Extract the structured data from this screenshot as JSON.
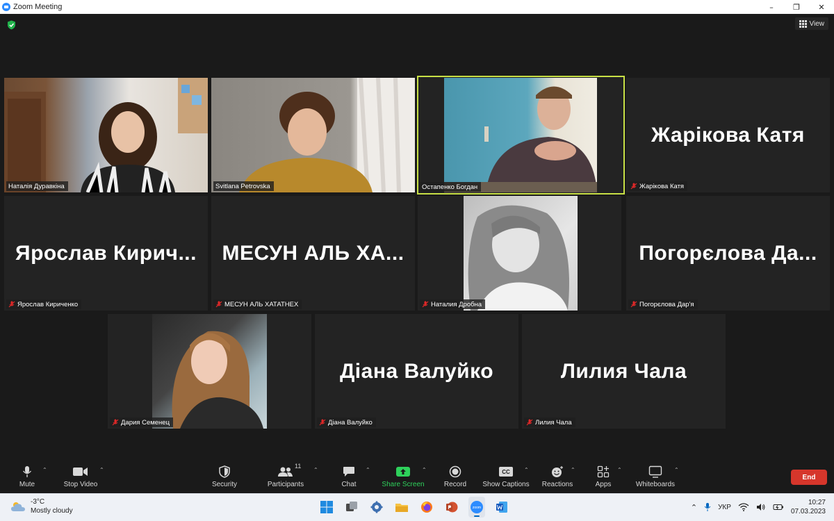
{
  "window": {
    "title": "Zoom Meeting",
    "controls": [
      "minimize",
      "maximize",
      "close"
    ]
  },
  "meeting": {
    "view_label": "View",
    "participants": [
      {
        "name": "Наталія Дуравкіна",
        "video": true,
        "muted": false,
        "active_speaker": false
      },
      {
        "name": "Svitlana Petrovska",
        "video": true,
        "muted": false,
        "active_speaker": false
      },
      {
        "name": "Остапенко Богдан",
        "video": true,
        "muted": false,
        "active_speaker": true
      },
      {
        "name": "Жарікова Катя",
        "display_name": "Жарікова Катя",
        "video": false,
        "muted": true,
        "active_speaker": false
      },
      {
        "name": "Ярослав Кириченко",
        "display_name": "Ярослав  Кирич...",
        "video": false,
        "muted": true,
        "active_speaker": false
      },
      {
        "name": "МЕСУН АЛЬ ХАТАТНЕХ",
        "display_name": "МЕСУН  АЛЬ  ХА...",
        "video": false,
        "muted": true,
        "active_speaker": false
      },
      {
        "name": "Наталия Дробна",
        "video": true,
        "muted": true,
        "active_speaker": false
      },
      {
        "name": "Погорєлова Дар'я",
        "display_name": "Погорєлова  Да...",
        "video": false,
        "muted": true,
        "active_speaker": false
      },
      {
        "name": "Дария Семенец",
        "video": true,
        "muted": true,
        "active_speaker": false
      },
      {
        "name": "Діана Валуйко",
        "display_name": "Діана Валуйко",
        "video": false,
        "muted": true,
        "active_speaker": false
      },
      {
        "name": "Лилия Чала",
        "display_name": "Лилия Чала",
        "video": false,
        "muted": true,
        "active_speaker": false
      }
    ]
  },
  "toolbar": {
    "mute": "Mute",
    "stop_video": "Stop Video",
    "security": "Security",
    "participants": "Participants",
    "participants_count": "11",
    "chat": "Chat",
    "share_screen": "Share Screen",
    "record": "Record",
    "show_captions": "Show Captions",
    "reactions": "Reactions",
    "apps": "Apps",
    "whiteboards": "Whiteboards",
    "end": "End",
    "cc_text": "CC",
    "share_color": "#2ed15b",
    "end_color": "#d6362b"
  },
  "taskbar": {
    "weather_temp": "-3°C",
    "weather_desc": "Mostly cloudy",
    "language": "УКР",
    "time": "10:27",
    "date": "07.03.2023",
    "apps": [
      "windows-start",
      "task-view",
      "settings",
      "file-explorer",
      "firefox",
      "powerpoint",
      "zoom",
      "word"
    ],
    "zoom_label": "zoom"
  }
}
